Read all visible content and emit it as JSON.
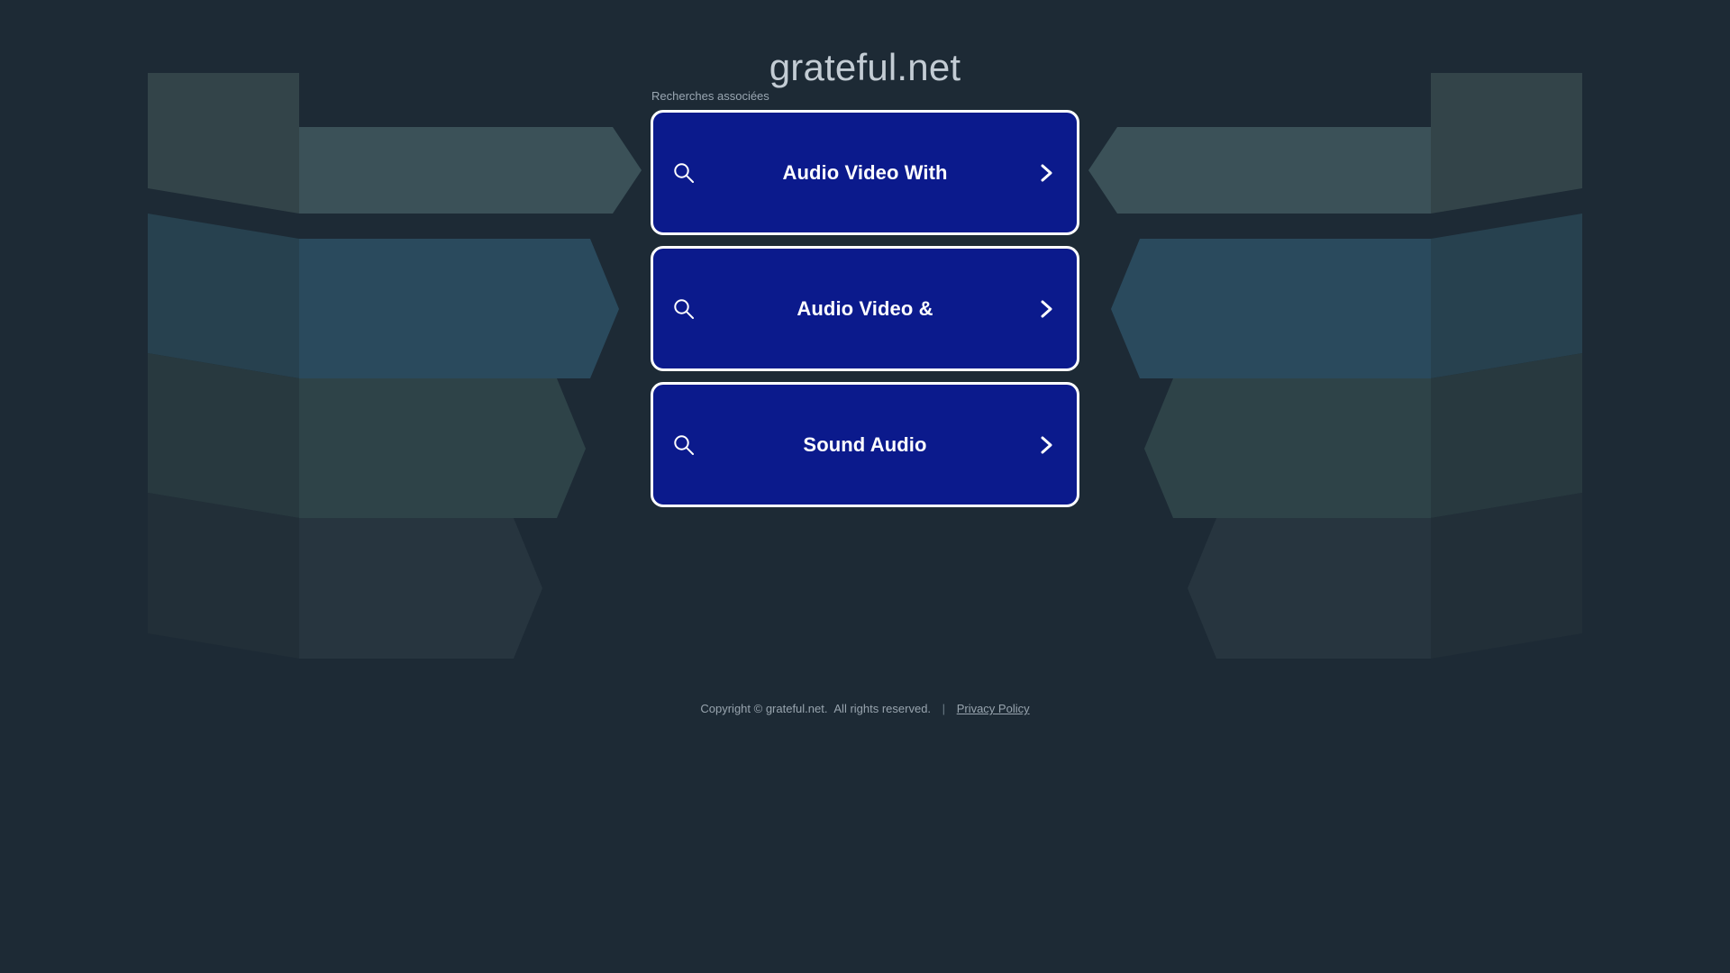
{
  "site": {
    "title": "grateful.net",
    "background_color": "#1d2a35",
    "accent_color": "#0b1a8c"
  },
  "related": {
    "label": "Recherches associées",
    "search_icon": "search-icon",
    "chevron_icon": "chevron-right-icon",
    "items": [
      {
        "label": "Audio Video With"
      },
      {
        "label": "Audio Video &"
      },
      {
        "label": "Sound Audio"
      }
    ]
  },
  "footer": {
    "copyright": "Copyright © grateful.net.",
    "rights": "All rights reserved.",
    "separator": "|",
    "privacy_label": "Privacy Policy"
  },
  "decor": {
    "band_colors": [
      "#3b5158",
      "#2a4a5d",
      "#2e4348",
      "#27353f"
    ],
    "wing_colors": [
      "#334449",
      "#27414f",
      "#28393f",
      "#222f38"
    ]
  }
}
